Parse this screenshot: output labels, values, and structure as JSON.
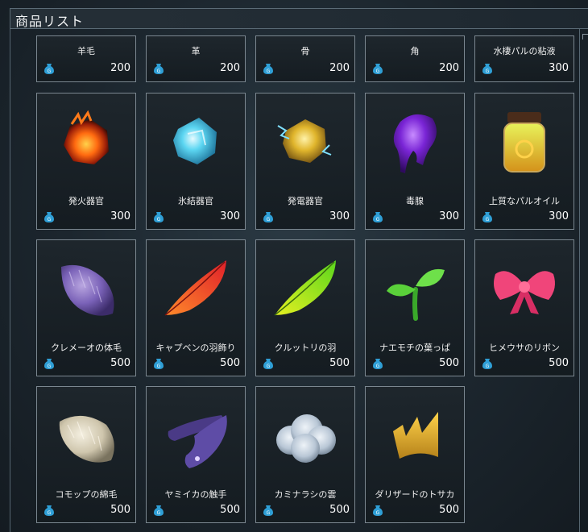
{
  "header": {
    "title": "商品リスト"
  },
  "currency_icon": "gold-coin-bag-icon",
  "items": [
    {
      "name": "羊毛",
      "price": "200",
      "icon": "wool-icon"
    },
    {
      "name": "革",
      "price": "200",
      "icon": "leather-icon"
    },
    {
      "name": "骨",
      "price": "200",
      "icon": "bone-icon"
    },
    {
      "name": "角",
      "price": "200",
      "icon": "horn-icon"
    },
    {
      "name": "水棲パルの粘液",
      "price": "300",
      "icon": "slime-icon"
    },
    {
      "name": "発火器官",
      "price": "300",
      "icon": "flame-organ-icon"
    },
    {
      "name": "氷結器官",
      "price": "300",
      "icon": "ice-organ-icon"
    },
    {
      "name": "発電器官",
      "price": "300",
      "icon": "electric-organ-icon"
    },
    {
      "name": "毒腺",
      "price": "300",
      "icon": "venom-gland-icon"
    },
    {
      "name": "上質なパルオイル",
      "price": "300",
      "icon": "pal-oil-jar-icon"
    },
    {
      "name": "クレメーオの体毛",
      "price": "500",
      "icon": "purple-fur-icon"
    },
    {
      "name": "キャプベンの羽飾り",
      "price": "500",
      "icon": "red-feather-icon"
    },
    {
      "name": "クルットリの羽",
      "price": "500",
      "icon": "green-feather-icon"
    },
    {
      "name": "ナエモチの葉っぱ",
      "price": "500",
      "icon": "sprout-leaf-icon"
    },
    {
      "name": "ヒメウサのリボン",
      "price": "500",
      "icon": "pink-ribbon-icon"
    },
    {
      "name": "コモップの綿毛",
      "price": "500",
      "icon": "white-fluff-icon"
    },
    {
      "name": "ヤミイカの触手",
      "price": "500",
      "icon": "tentacle-icon"
    },
    {
      "name": "カミナラシの雲",
      "price": "500",
      "icon": "cloud-icon"
    },
    {
      "name": "ダリザードのトサカ",
      "price": "500",
      "icon": "golden-crest-icon"
    }
  ]
}
